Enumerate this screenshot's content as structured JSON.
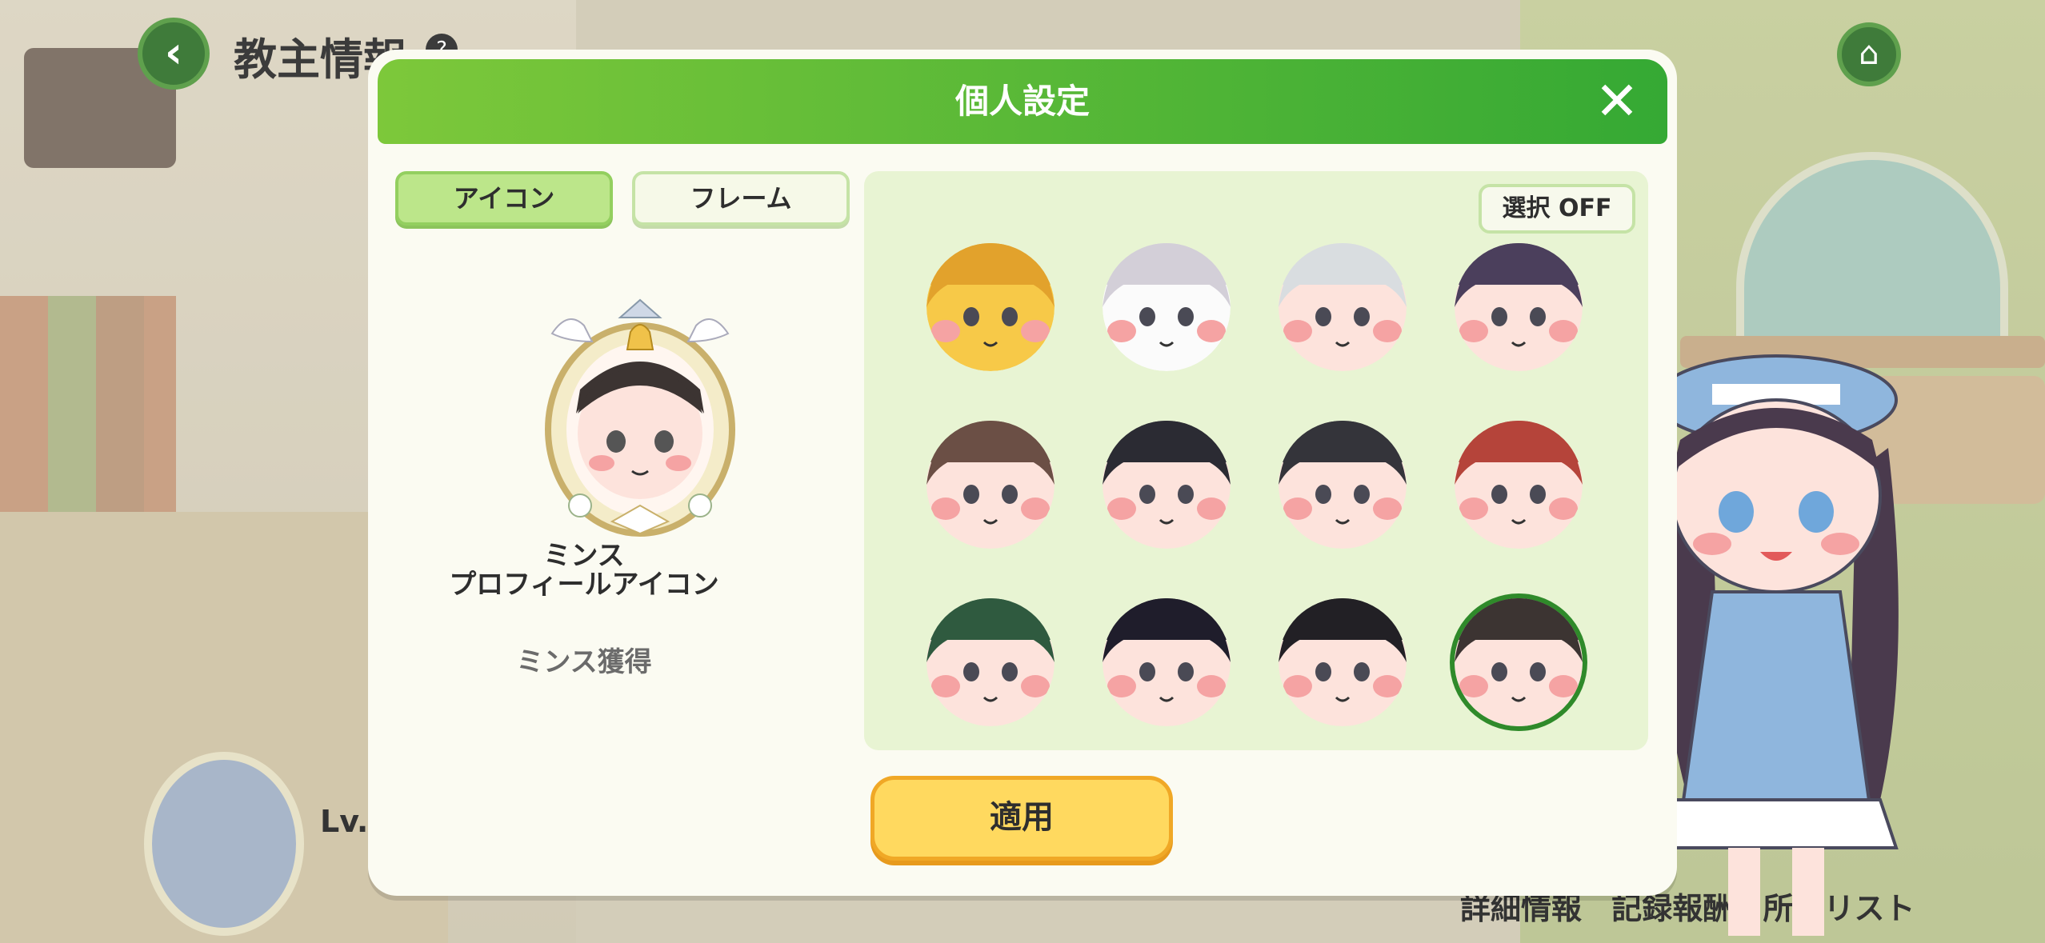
{
  "header": {
    "back_icon": "chevron-left-icon",
    "title": "教主情報",
    "help_icon": "question-icon",
    "home_icon": "home-icon"
  },
  "profile_bar": {
    "level_label": "Lv.S"
  },
  "bottom_links": [
    "詳細情報",
    "記録報酬",
    "所品リスト"
  ],
  "modal": {
    "title": "個人設定",
    "close_icon": "close-icon",
    "tabs": [
      {
        "label": "アイコン",
        "active": true
      },
      {
        "label": "フレーム",
        "active": false
      }
    ],
    "preview": {
      "name_line1": "ミンス",
      "name_line2": "プロフィールアイコン",
      "source": "ミンス獲得"
    },
    "select_toggle_label": "選択 OFF",
    "apply_label": "適用",
    "icons": [
      {
        "name": "yellow-bee-avatar-icon",
        "skin": "#f7c948",
        "hair": "#e2a22c",
        "selected": false
      },
      {
        "name": "pumpkin-ghost-avatar-icon",
        "skin": "#fbfbfb",
        "hair": "#d3cfd8",
        "selected": false
      },
      {
        "name": "silver-hair-avatar-icon",
        "skin": "#fde3dc",
        "hair": "#d9dde0",
        "selected": false
      },
      {
        "name": "purple-hair-avatar-icon",
        "skin": "#fde3dc",
        "hair": "#4b3f5c",
        "selected": false
      },
      {
        "name": "brown-hair-headband-avatar-icon",
        "skin": "#fde3dc",
        "hair": "#6b4f45",
        "selected": false
      },
      {
        "name": "black-cap-avatar-icon",
        "skin": "#fde3dc",
        "hair": "#2b2b33",
        "selected": false
      },
      {
        "name": "black-beanie-avatar-icon",
        "skin": "#fde3dc",
        "hair": "#34343a",
        "selected": false
      },
      {
        "name": "red-cap-sunglasses-avatar-icon",
        "skin": "#fde3dc",
        "hair": "#b5443a",
        "selected": false
      },
      {
        "name": "green-hair-avatar-icon",
        "skin": "#fde3dc",
        "hair": "#2f5a3f",
        "selected": false
      },
      {
        "name": "dark-navy-hair-avatar-icon",
        "skin": "#fde3dc",
        "hair": "#1f1d2b",
        "selected": false
      },
      {
        "name": "black-hair-avatar-icon",
        "skin": "#fde3dc",
        "hair": "#222025",
        "selected": false
      },
      {
        "name": "minsu-avatar-icon",
        "skin": "#fde3dc",
        "hair": "#3c3432",
        "selected": true
      }
    ]
  },
  "colors": {
    "header_green_start": "#7dc83a",
    "header_green_end": "#35a934",
    "apply_yellow": "#ffd95f",
    "active_tab": "#bce68a",
    "grid_panel": "#e8f4d3"
  }
}
